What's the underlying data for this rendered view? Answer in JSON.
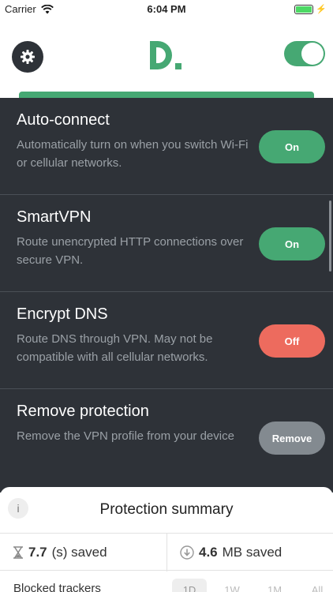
{
  "status_bar": {
    "carrier": "Carrier",
    "time": "6:04 PM"
  },
  "header": {
    "logo_text": "D.",
    "vpn_enabled": true,
    "brand_color": "#46a873"
  },
  "settings": [
    {
      "title": "Auto-connect",
      "description": "Automatically turn on when you switch Wi-Fi or cellular networks.",
      "button": "On",
      "state": "on"
    },
    {
      "title": "SmartVPN",
      "description": "Route unencrypted HTTP connections over secure VPN.",
      "button": "On",
      "state": "on"
    },
    {
      "title": "Encrypt DNS",
      "description": "Route DNS through VPN. May not be compatible with all cellular networks.",
      "button": "Off",
      "state": "off"
    },
    {
      "title": "Remove protection",
      "description": "Remove the VPN profile from your device",
      "button": "Remove",
      "state": "neutral"
    }
  ],
  "summary": {
    "info_label": "i",
    "title": "Protection summary",
    "time_saved_value": "7.7",
    "time_saved_label": "(s) saved",
    "data_saved_value": "4.6",
    "data_saved_label": "MB saved",
    "trackers_label": "Blocked trackers",
    "ranges": [
      "1D",
      "1W",
      "1M",
      "All"
    ],
    "active_range": "1D"
  },
  "colors": {
    "panel_bg": "#2e3238",
    "on": "#46a873",
    "off": "#ed6b5e",
    "remove": "#838a90"
  }
}
